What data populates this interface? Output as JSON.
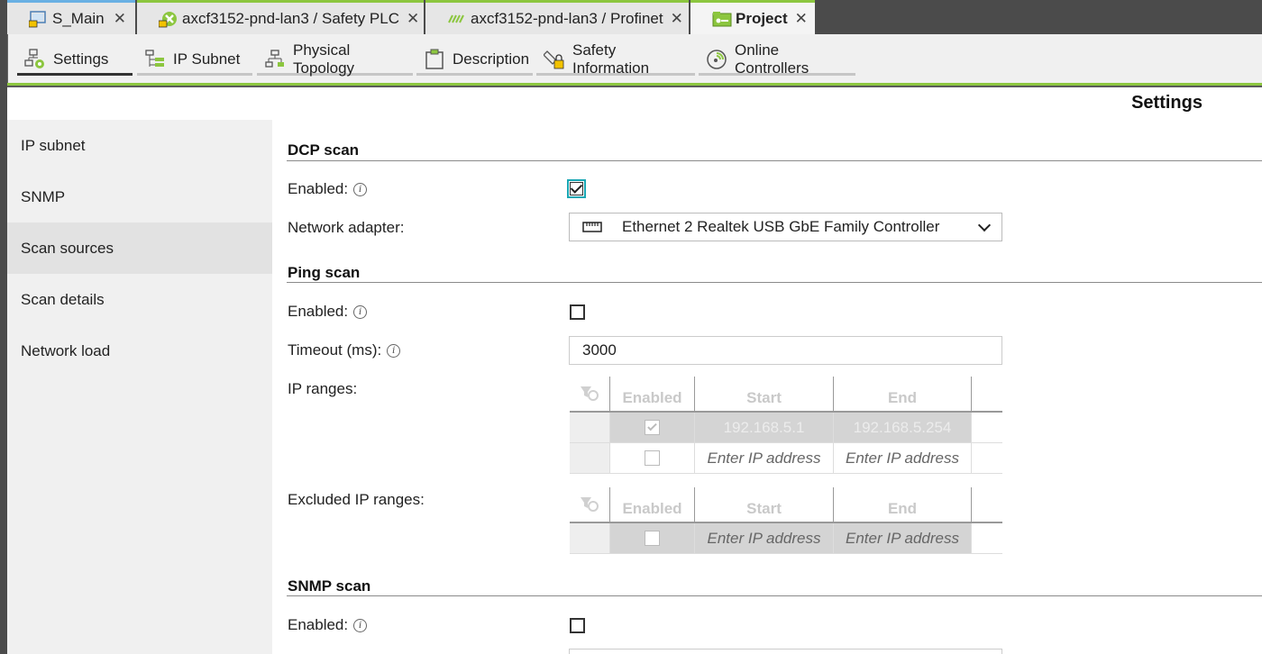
{
  "doc_tabs": [
    {
      "label": "S_Main",
      "icon": "workstation-icon"
    },
    {
      "label": "axcf3152-pnd-lan3 / Safety PLC",
      "icon": "safety-plc-icon"
    },
    {
      "label": "axcf3152-pnd-lan3 / Profinet",
      "icon": "profinet-icon"
    },
    {
      "label": "Project",
      "icon": "project-icon"
    }
  ],
  "close_glyph": "✕",
  "editor_tabs": [
    {
      "label": "Settings",
      "icon": "settings-network-icon"
    },
    {
      "label": "IP Subnet",
      "icon": "ip-subnet-icon"
    },
    {
      "label": "Physical Topology",
      "icon": "topology-icon"
    },
    {
      "label": "Description",
      "icon": "clipboard-icon"
    },
    {
      "label": "Safety Information",
      "icon": "safety-lock-icon"
    },
    {
      "label": "Online Controllers",
      "icon": "online-controllers-icon"
    }
  ],
  "page_title": "Settings",
  "sidenav": [
    "IP subnet",
    "SNMP",
    "Scan sources",
    "Scan details",
    "Network load"
  ],
  "sidenav_active": "Scan sources",
  "dcp": {
    "title": "DCP scan",
    "enabled_label": "Enabled:",
    "enabled": true,
    "adapter_label": "Network adapter:",
    "adapter_value": "Ethernet 2 Realtek USB GbE Family Controller"
  },
  "ping": {
    "title": "Ping scan",
    "enabled_label": "Enabled:",
    "enabled": false,
    "timeout_label": "Timeout (ms):",
    "timeout_value": "3000",
    "ip_ranges_label": "IP ranges:",
    "excluded_label": "Excluded IP ranges:",
    "columns": [
      "Enabled",
      "Start",
      "End"
    ],
    "ip_ranges": [
      {
        "enabled": true,
        "start": "192.168.5.1",
        "end": "192.168.5.254"
      },
      {
        "enabled": false,
        "start": "Enter IP address",
        "end": "Enter IP address"
      }
    ],
    "excluded_ranges": [
      {
        "enabled": false,
        "start": "Enter IP address",
        "end": "Enter IP address"
      }
    ]
  },
  "snmp": {
    "title": "SNMP scan",
    "enabled_label": "Enabled:",
    "enabled": false
  },
  "info_glyph": "i",
  "colors": {
    "accent_green": "#8cc63f",
    "focus_teal": "#1aa7b4",
    "tab_blue": "#69b0e3"
  }
}
